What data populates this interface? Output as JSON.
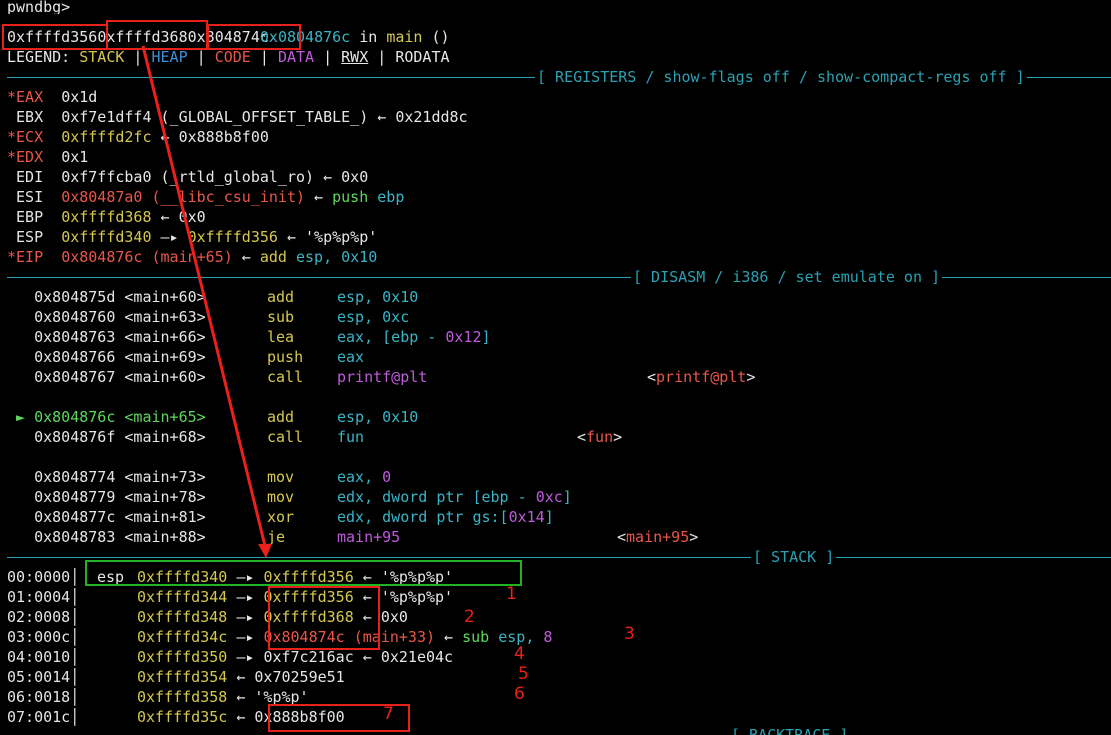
{
  "header": {
    "prompt": "pwndbg>",
    "frame_text": "0xffffd3560xffffd3680x804874c0x0804876c in main ()",
    "frame_addr": "0x0804876c",
    "frame_in": " in ",
    "frame_func": "main",
    "frame_args": " ()",
    "frame_prefix_1": "0xffffd356",
    "frame_prefix_2": "0xffffd368",
    "frame_prefix_3": "0x804874c"
  },
  "legend": {
    "label": "LEGEND: ",
    "stack": "STACK",
    "heap": "HEAP",
    "code": "CODE",
    "data": "DATA",
    "rwx": "RWX",
    "rodata": "RODATA",
    "pipe": " | "
  },
  "sections": {
    "registers": "[ REGISTERS / show-flags off / show-compact-regs off ]",
    "disasm": "[ DISASM / i386 / set emulate on ]",
    "stack": "[ STACK ]",
    "backtrace": "[ BACKTRACE ]"
  },
  "registers": [
    {
      "mark": "*",
      "name": "EAX",
      "value": "0x1d",
      "rest": ""
    },
    {
      "mark": " ",
      "name": "EBX",
      "value": "0xf7e1dff4",
      "rest": " (_GLOBAL_OFFSET_TABLE_) ← 0x21dd8c"
    },
    {
      "mark": "*",
      "name": "ECX",
      "value": "0xffffd2fc",
      "rest": " ← 0x888b8f00"
    },
    {
      "mark": "*",
      "name": "EDX",
      "value": "0x1",
      "rest": ""
    },
    {
      "mark": " ",
      "name": "EDI",
      "value": "0xf7ffcba0",
      "rest": " (_rtld_global_ro) ← 0x0"
    },
    {
      "mark": " ",
      "name": "ESI",
      "value": "0x80487a0",
      "sym": " (__libc_csu_init)",
      "arrow": " ← ",
      "ins": "push",
      "op": " ebp"
    },
    {
      "mark": " ",
      "name": "EBP",
      "value": "0xffffd368",
      "rest": " ← 0x0"
    },
    {
      "mark": " ",
      "name": "ESP",
      "value": "0xffffd340",
      "arrow": " —▸ ",
      "value2": "0xffffd356",
      "rest": " ← '%p%p%p'"
    },
    {
      "mark": "*",
      "name": "EIP",
      "value": "0x804876c",
      "sym": " (main+65)",
      "arrow": " ← ",
      "ins": "add",
      "op": " esp, ",
      "imm": "0x10"
    }
  ],
  "disasm": [
    {
      "cur": false,
      "addr": "0x804875d",
      "loc": "<main+60>",
      "mn": "add",
      "ops": [
        [
          "esp, ",
          "c-cyan"
        ],
        [
          "0x10",
          "c-cyan"
        ]
      ],
      "target": ""
    },
    {
      "cur": false,
      "addr": "0x8048760",
      "loc": "<main+63>",
      "mn": "sub",
      "ops": [
        [
          "esp, ",
          "c-cyan"
        ],
        [
          "0xc",
          "c-cyan"
        ]
      ],
      "target": ""
    },
    {
      "cur": false,
      "addr": "0x8048763",
      "loc": "<main+66>",
      "mn": "lea",
      "ops": [
        [
          "eax, [ebp - ",
          "c-cyan"
        ],
        [
          "0x12",
          "c-purple"
        ],
        [
          "]",
          "c-cyan"
        ]
      ],
      "target": ""
    },
    {
      "cur": false,
      "addr": "0x8048766",
      "loc": "<main+69>",
      "mn": "push",
      "ops": [
        [
          "eax",
          "c-cyan"
        ]
      ],
      "target": ""
    },
    {
      "cur": false,
      "addr": "0x8048767",
      "loc": "<main+60>",
      "mn": "call",
      "ops": [
        [
          "printf@plt",
          "c-purple"
        ]
      ],
      "target": "<printf@plt>"
    },
    {
      "cur": true,
      "addr": "0x804876c",
      "loc": "<main+65>",
      "mn": "add",
      "ops": [
        [
          "esp, ",
          "c-cyan"
        ],
        [
          "0x10",
          "c-cyan"
        ]
      ],
      "target": ""
    },
    {
      "cur": false,
      "addr": "0x804876f",
      "loc": "<main+68>",
      "mn": "call",
      "ops": [
        [
          "fun",
          "c-cyan"
        ]
      ],
      "target": "<fun>"
    },
    {
      "cur": false,
      "addr": "0x8048774",
      "loc": "<main+73>",
      "mn": "mov",
      "ops": [
        [
          "eax, ",
          "c-cyan"
        ],
        [
          "0",
          "c-purple"
        ]
      ],
      "target": ""
    },
    {
      "cur": false,
      "addr": "0x8048779",
      "loc": "<main+78>",
      "mn": "mov",
      "ops": [
        [
          "edx, dword ptr [ebp - ",
          "c-cyan"
        ],
        [
          "0xc",
          "c-purple"
        ],
        [
          "]",
          "c-cyan"
        ]
      ],
      "target": ""
    },
    {
      "cur": false,
      "addr": "0x804877c",
      "loc": "<main+81>",
      "mn": "xor",
      "ops": [
        [
          "edx, dword ptr gs:[",
          "c-cyan"
        ],
        [
          "0x14",
          "c-purple"
        ],
        [
          "]",
          "c-cyan"
        ]
      ],
      "target": ""
    },
    {
      "cur": false,
      "addr": "0x8048783",
      "loc": "<main+88>",
      "mn": "je",
      "ops": [
        [
          "main+95",
          "c-purple"
        ]
      ],
      "target": "<main+95>"
    }
  ],
  "stack": [
    {
      "idx": "00:0000",
      "reg": "esp",
      "addr": "0xffffd340",
      "arrow": " —▸ ",
      "val": "0xffffd356",
      "valcls": "c-yellow",
      "rest": " ← '%p%p%p'",
      "num": ""
    },
    {
      "idx": "01:0004",
      "reg": "",
      "addr": "0xffffd344",
      "arrow": " —▸ ",
      "val": "0xffffd356",
      "valcls": "c-yellow",
      "rest": " ← '%p%p%p'",
      "num": "1"
    },
    {
      "idx": "02:0008",
      "reg": "",
      "addr": "0xffffd348",
      "arrow": " —▸ ",
      "val": "0xffffd368",
      "valcls": "c-yellow",
      "rest": " ← 0x0",
      "num": "2"
    },
    {
      "idx": "03:000c",
      "reg": "",
      "addr": "0xffffd34c",
      "arrow": " —▸ ",
      "val": "0x804874c",
      "valcls": "c-red",
      "sym": " (main+33)",
      "arrow2": " ← ",
      "ins": "sub",
      "op": " esp, ",
      "imm": "8",
      "num": "3"
    },
    {
      "idx": "04:0010",
      "reg": "",
      "addr": "0xffffd350",
      "arrow": " —▸ ",
      "val": "0xf7c216ac",
      "valcls": "c-white",
      "rest": " ← 0x21e04c",
      "num": "4"
    },
    {
      "idx": "05:0014",
      "reg": "",
      "addr": "0xffffd354",
      "arrow": " ← ",
      "val": "0x70259e51",
      "valcls": "c-white",
      "rest": "",
      "num": "5"
    },
    {
      "idx": "06:0018",
      "reg": "",
      "addr": "0xffffd358",
      "arrow": " ← ",
      "val": "'%p%p'",
      "valcls": "c-white",
      "rest": "",
      "num": "6"
    },
    {
      "idx": "07:001c",
      "reg": "",
      "addr": "0xffffd35c",
      "arrow": " ← ",
      "val": "0x888b8f00",
      "valcls": "c-white",
      "rest": "",
      "num": "7"
    }
  ],
  "colors": {
    "annotation_red": "#e8211b",
    "annotation_green": "#22b322"
  }
}
